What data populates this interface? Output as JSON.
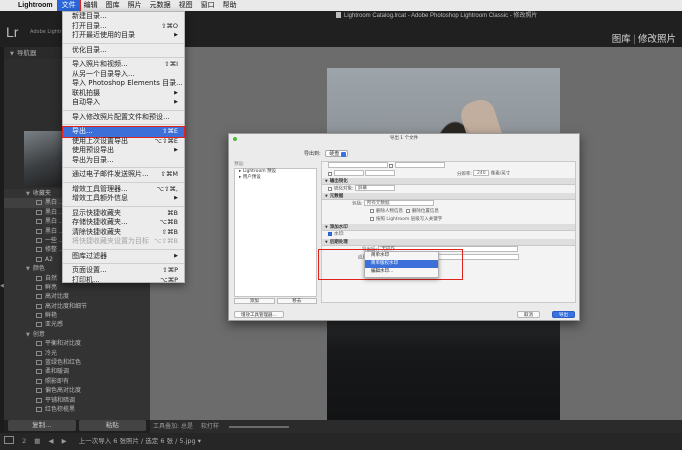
{
  "menubar": {
    "items": [
      "Lightroom",
      "文件",
      "编辑",
      "图库",
      "照片",
      "元数据",
      "视图",
      "窗口",
      "帮助"
    ],
    "active": "文件"
  },
  "window": {
    "title": "Lightroom Catalog.lrcat - Adobe Photoshop Lightroom Classic - 修改照片",
    "logo": "Lr",
    "logo_sub": "Adobe Lightroom",
    "modules": [
      "图库",
      "修改照片"
    ]
  },
  "left_panel": {
    "navigator": "导航器",
    "presets_title": "预设",
    "presets": [
      {
        "label": "收藏夹",
        "level": 1
      },
      {
        "label": "黑白 …",
        "level": 2
      },
      {
        "label": "黑白 …",
        "level": 2
      },
      {
        "label": "黑白 …",
        "level": 2
      },
      {
        "label": "黑白 …",
        "level": 2
      },
      {
        "label": "一些 …",
        "level": 2
      },
      {
        "label": "修整 …",
        "level": 2
      },
      {
        "label": "A2",
        "level": 2
      },
      {
        "label": "颜色",
        "level": 1
      },
      {
        "label": "自然",
        "level": 2
      },
      {
        "label": "鲜亮",
        "level": 2
      },
      {
        "label": "高对比度",
        "level": 2
      },
      {
        "label": "高对比度和细节",
        "level": 2
      },
      {
        "label": "鲜艳",
        "level": 2
      },
      {
        "label": "亚光感",
        "level": 2
      },
      {
        "label": "创意",
        "level": 1
      },
      {
        "label": "平衡和对比度",
        "level": 2
      },
      {
        "label": "冷光",
        "level": 2
      },
      {
        "label": "蓝绿色和红色",
        "level": 2
      },
      {
        "label": "柔和暖调",
        "level": 2
      },
      {
        "label": "照影即有",
        "level": 2
      },
      {
        "label": "偏色高对比度",
        "level": 2
      },
      {
        "label": "平铺和暗调",
        "level": 2
      },
      {
        "label": "红色棕榄黑",
        "level": 2
      }
    ],
    "copy_button": "复制...",
    "paste_button": "粘贴"
  },
  "file_menu": {
    "items": [
      {
        "label": "新建目录...",
        "shortcut": ""
      },
      {
        "label": "打开目录...",
        "shortcut": "⇧⌘O"
      },
      {
        "label": "打开最近使用的目录",
        "shortcut": "",
        "submenu": true
      },
      {
        "sep": true
      },
      {
        "label": "优化目录...",
        "shortcut": ""
      },
      {
        "sep": true
      },
      {
        "label": "导入照片和视频...",
        "shortcut": "⇧⌘I"
      },
      {
        "label": "从另一个目录导入...",
        "shortcut": ""
      },
      {
        "label": "导入 Photoshop Elements 目录...",
        "shortcut": ""
      },
      {
        "label": "联机拍摄",
        "shortcut": "",
        "submenu": true
      },
      {
        "label": "自动导入",
        "shortcut": "",
        "submenu": true
      },
      {
        "sep": true
      },
      {
        "label": "导入修改照片配置文件和预设...",
        "shortcut": ""
      },
      {
        "sep": true
      },
      {
        "label": "导出...",
        "shortcut": "⇧⌘E",
        "selected": true
      },
      {
        "label": "使用上次设置导出",
        "shortcut": "⌥⇧⌘E"
      },
      {
        "label": "使用预设导出",
        "shortcut": "",
        "submenu": true
      },
      {
        "label": "导出为目录...",
        "shortcut": ""
      },
      {
        "sep": true
      },
      {
        "label": "通过电子邮件发送照片...",
        "shortcut": "⇧⌘M"
      },
      {
        "sep": true
      },
      {
        "label": "增效工具管理器...",
        "shortcut": "⌥⇧⌘,"
      },
      {
        "label": "增效工具额外信息",
        "shortcut": "",
        "submenu": true
      },
      {
        "sep": true
      },
      {
        "label": "显示快捷收藏夹",
        "shortcut": "⌘B"
      },
      {
        "label": "存储快捷收藏夹...",
        "shortcut": "⌥⌘B"
      },
      {
        "label": "清除快捷收藏夹",
        "shortcut": "⇧⌘B"
      },
      {
        "label": "将快捷收藏夹设置为目标",
        "shortcut": "⌥⇧⌘B",
        "disabled": true
      },
      {
        "sep": true
      },
      {
        "label": "图库过滤器",
        "shortcut": "",
        "submenu": true
      },
      {
        "sep": true
      },
      {
        "label": "页面设置...",
        "shortcut": "⇧⌘P"
      },
      {
        "label": "打印机...",
        "shortcut": "⌥⌘P"
      }
    ]
  },
  "export_dialog": {
    "title": "导出 1 个文件",
    "export_to_label": "导出到:",
    "export_to_value": "硬盘",
    "preset_label": "预设:",
    "preset_items": [
      "Lightroom 预设",
      "用户预设"
    ],
    "add_button": "添加",
    "remove_button": "移去",
    "plugin_manager_button": "增效工具管理器...",
    "cancel_button": "取消",
    "export_button": "导出",
    "sections": {
      "output_sharpening": "输出锐化",
      "sharpen_for_label": "锐化对象:",
      "sharpen_for_value": "屏幕",
      "metadata": "元数据",
      "include_label": "包括:",
      "include_value": "所有元数据",
      "remove_person_info": "删除人物信息",
      "remove_location_info": "删除位置信息",
      "write_keywords": "按照 Lightroom 层级写入关键字",
      "watermark": "添加水印",
      "watermark_checkbox": "水印:",
      "post_processing": "后期处理",
      "after_export_label": "导出后:",
      "after_export_value": "无操作",
      "application_label": "应用程序:",
      "application_placeholder": "请选择应用程序"
    },
    "size_row": {
      "resolution_label": "分辨率:",
      "resolution_value": "240",
      "resolution_unit": "像素/英寸"
    },
    "watermark_popup": [
      "简单水印",
      "简单版权水印",
      "编辑水印..."
    ],
    "watermark_popup_selected": 1
  },
  "center_toolbar": {
    "left": "工具叠加:",
    "mode": "总是",
    "right": "软打样"
  },
  "filmstrip": {
    "page_buttons": [
      "1",
      "2"
    ],
    "status": "上一次导入   6 张照片 / 选定 6 张 / 5.jpg",
    "dropdown": "▾"
  }
}
